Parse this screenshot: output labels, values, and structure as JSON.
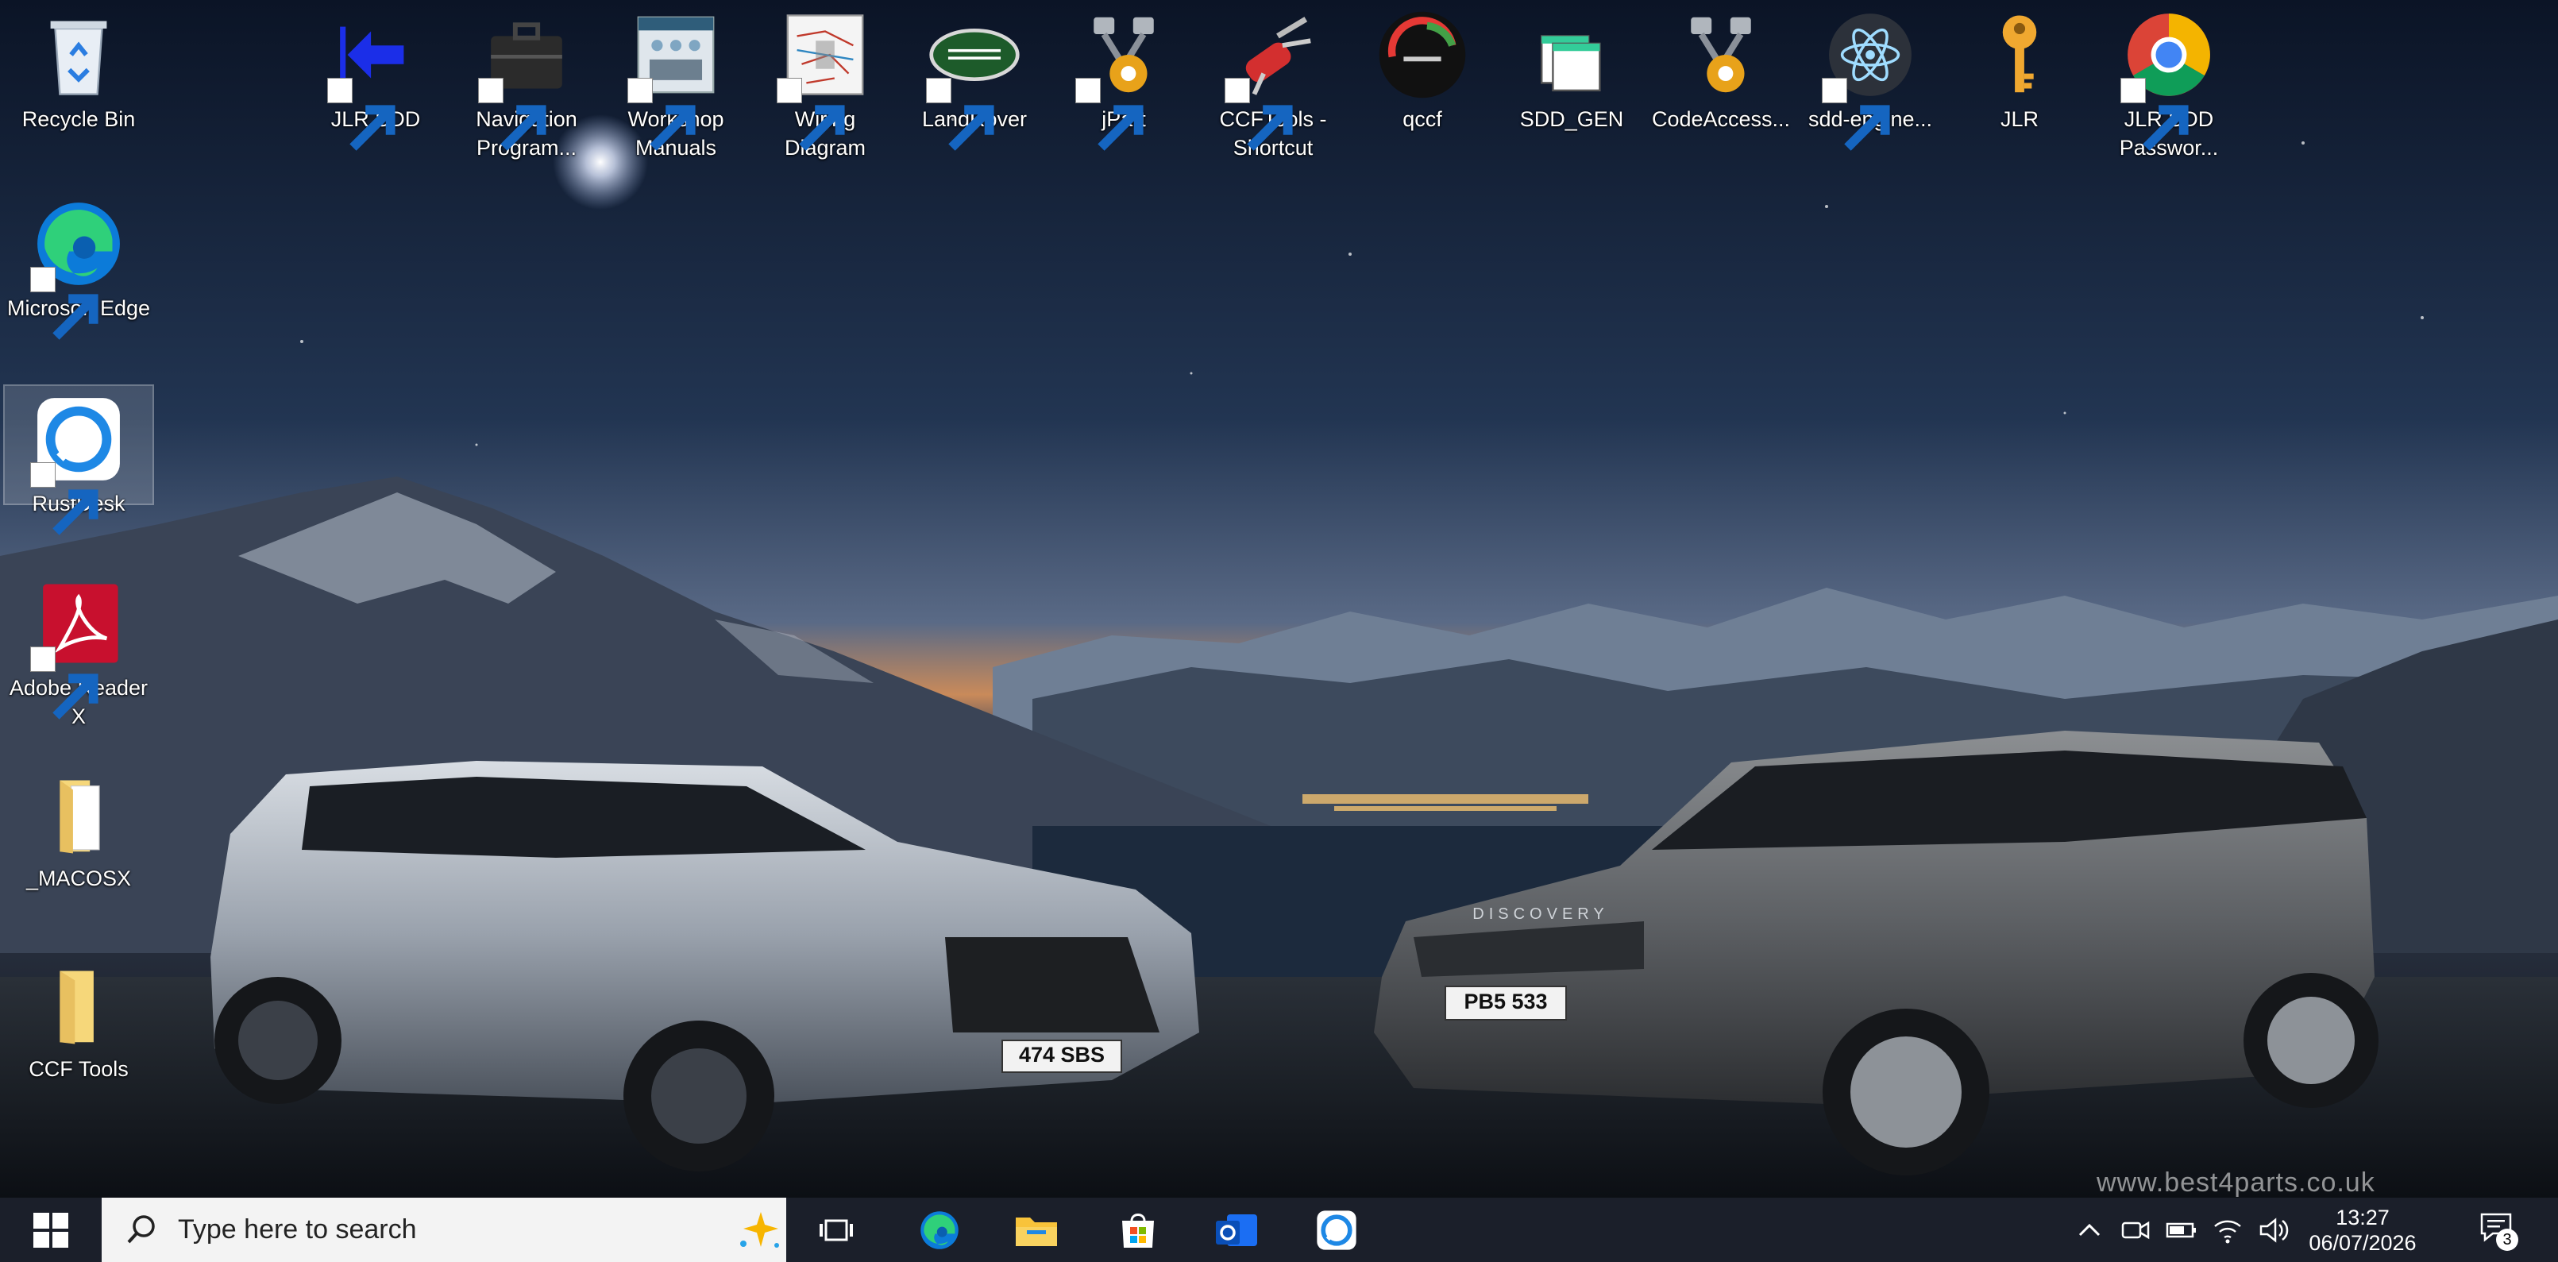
{
  "desktop": {
    "icons": [
      {
        "label": "Recycle Bin",
        "icon": "recycle-bin-icon"
      },
      {
        "label": "JLR SDD",
        "icon": "jlr-sdd-icon"
      },
      {
        "label": "Navigation Program...",
        "icon": "briefcase-icon"
      },
      {
        "label": "Workshop Manuals",
        "icon": "workshop-manuals-icon"
      },
      {
        "label": "Wiring Diagram",
        "icon": "wiring-diagram-icon"
      },
      {
        "label": "LandRover",
        "icon": "landrover-logo-icon"
      },
      {
        "label": "jPart",
        "icon": "pistons-gear-icon"
      },
      {
        "label": "CCFTools - Shortcut",
        "icon": "swiss-knife-icon"
      },
      {
        "label": "qccf",
        "icon": "gauge-icon"
      },
      {
        "label": "SDD_GEN",
        "icon": "windows-stack-icon"
      },
      {
        "label": "CodeAccess...",
        "icon": "pistons-gear-icon"
      },
      {
        "label": "sdd-engine...",
        "icon": "atom-icon"
      },
      {
        "label": "JLR",
        "icon": "key-icon"
      },
      {
        "label": "JLR SDD Passwor...",
        "icon": "chrome-icon"
      },
      {
        "label": "Microsoft Edge",
        "icon": "edge-icon"
      },
      {
        "label": "RustDesk",
        "icon": "rustdesk-icon"
      },
      {
        "label": "Adobe Reader X",
        "icon": "adobe-reader-icon"
      },
      {
        "label": "_MACOSX",
        "icon": "folder-icon"
      },
      {
        "label": "CCF Tools",
        "icon": "folder-icon"
      }
    ],
    "wallpaper": {
      "plate_left": "474 SBS",
      "plate_right": "PB5 533",
      "badge_right": "DISCOVERY",
      "watermark": "www.best4parts.co.uk"
    }
  },
  "taskbar": {
    "search_placeholder": "Type here to search",
    "pinned": [
      "task-view-icon",
      "edge-icon",
      "file-explorer-icon",
      "store-icon",
      "outlook-icon",
      "rustdesk-icon"
    ],
    "time": "13:27",
    "date": "06/07/2026",
    "notification_count": "3"
  },
  "colors": {
    "taskbar": "#1b1f2a",
    "sky_top": "#0b1426",
    "sky_horizon": "#c98a5a",
    "accent_blue": "#1b6ef3"
  }
}
